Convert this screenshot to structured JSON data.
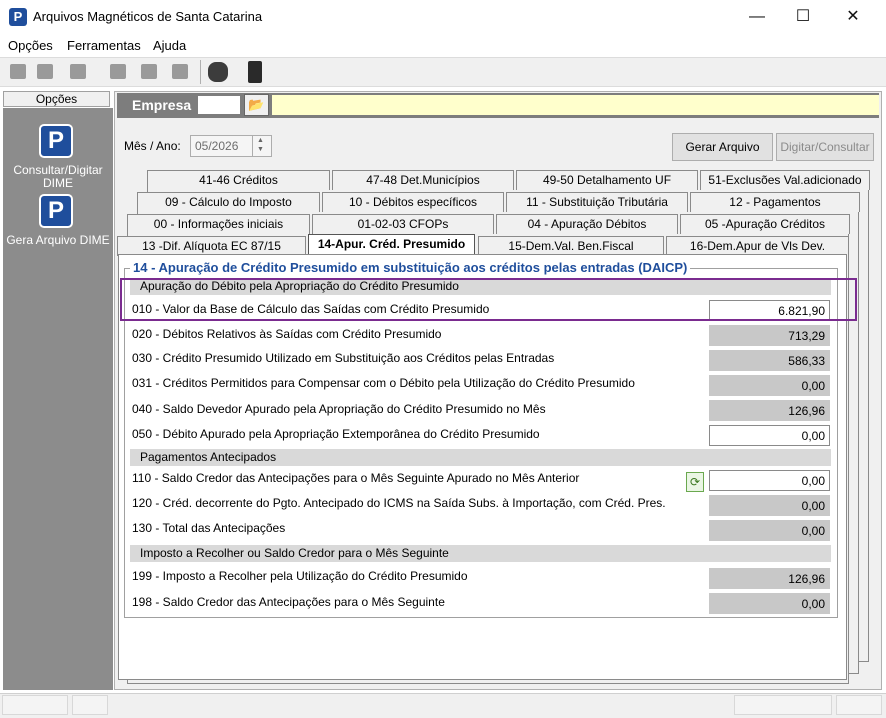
{
  "window": {
    "title": "Arquivos Magnéticos de Santa Catarina",
    "app_icon_letter": "P",
    "controls": {
      "minimize": "—",
      "maximize": "☐",
      "close": "✕"
    }
  },
  "menu": [
    "Opções",
    "Ferramentas",
    "Ajuda"
  ],
  "sidebar": {
    "header": "Opções",
    "items": [
      {
        "label": "Consultar/Digitar DIME",
        "icon": "P"
      },
      {
        "label": "Gera Arquivo DIME",
        "icon": "P"
      }
    ]
  },
  "empresa": {
    "label": "Empresa",
    "folder_icon": "📂"
  },
  "periodo": {
    "label": "Mês / Ano:",
    "value": "05/2026"
  },
  "buttons": {
    "gerar": "Gerar Arquivo",
    "digitar": "Digitar/Consultar"
  },
  "tabs": {
    "row1": [
      "41-46   Créditos",
      "47-48   Det.Municípios",
      "49-50   Detalhamento UF",
      "51-Exclusões Val.adicionado"
    ],
    "row2": [
      "09 - Cálculo do Imposto",
      "10 - Débitos específicos",
      "11 - Substituição Tributária",
      "12 - Pagamentos"
    ],
    "row3": [
      "00 - Informações iniciais",
      "01-02-03   CFOPs",
      "04 - Apuração Débitos",
      "05 -Apuração Créditos"
    ],
    "row4": [
      "13 -Dif. Alíquota EC 87/15",
      "14-Apur. Créd. Presumido",
      "15-Dem.Val. Ben.Fiscal",
      "16-Dem.Apur de Vls Dev."
    ]
  },
  "section": {
    "title": "14 - Apuração de Crédito Presumido em substituição aos créditos pelas entradas (DAICP)",
    "groups": [
      {
        "header": "Apuração do Débito pela Apropriação do Crédito Presumido",
        "rows": [
          {
            "label": "010 - Valor da Base de Cálculo das Saídas com Crédito Presumido",
            "value": "6.821,90",
            "editable": true
          },
          {
            "label": "020 - Débitos Relativos às Saídas com Crédito Presumido",
            "value": "713,29",
            "editable": false
          },
          {
            "label": "030 - Crédito Presumido Utilizado em Substituição aos Créditos pelas Entradas",
            "value": "586,33",
            "editable": false
          },
          {
            "label": "031 - Créditos Permitidos para Compensar com o Débito pela Utilização do Crédito Presumido",
            "value": "0,00",
            "editable": false
          },
          {
            "label": "040 - Saldo Devedor Apurado pela Apropriação do Crédito Presumido no Mês",
            "value": "126,96",
            "editable": false
          },
          {
            "label": "050 - Débito Apurado pela Apropriação Extemporânea do Crédito Presumido",
            "value": "0,00",
            "editable": true
          }
        ]
      },
      {
        "header": "Pagamentos Antecipados",
        "rows": [
          {
            "label": "110 - Saldo Credor das Antecipações para o Mês Seguinte Apurado no Mês Anterior",
            "value": "0,00",
            "editable": true
          },
          {
            "label": "120 - Créd. decorrente do Pgto. Antecipado do ICMS na Saída Subs. à Importação, com Créd. Pres.",
            "value": "0,00",
            "editable": false
          },
          {
            "label": "130 - Total das Antecipações",
            "value": "0,00",
            "editable": false
          }
        ]
      },
      {
        "header": "Imposto a Recolher ou Saldo Credor para o Mês Seguinte",
        "rows": [
          {
            "label": "199 - Imposto a Recolher pela Utilização do Crédito Presumido",
            "value": "126,96",
            "editable": false
          },
          {
            "label": "198 - Saldo Credor das Antecipações para o Mês Seguinte",
            "value": "0,00",
            "editable": false
          }
        ]
      }
    ]
  },
  "colors": {
    "accent": "#1f4e9c",
    "highlight": "#7a2b8f",
    "readonly": "#c8c8c8",
    "empresa_name_bg": "#ffffcc"
  }
}
